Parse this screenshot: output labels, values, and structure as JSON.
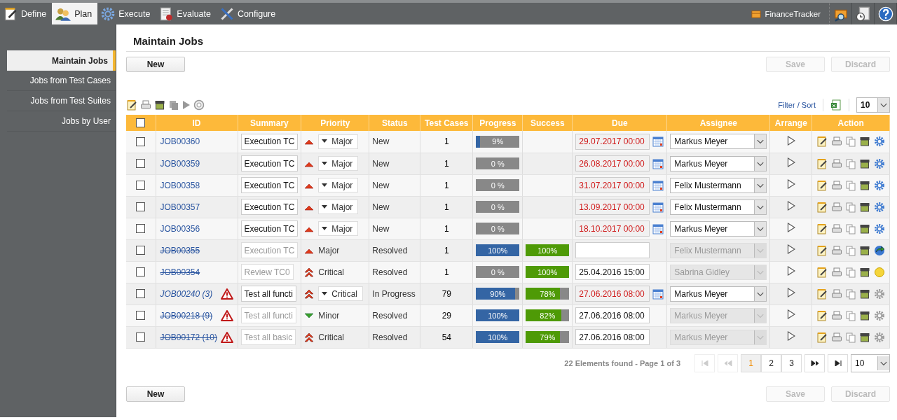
{
  "app": {
    "tabs": [
      {
        "label": "Define",
        "selected": false
      },
      {
        "label": "Plan",
        "selected": true
      },
      {
        "label": "Execute",
        "selected": false
      },
      {
        "label": "Evaluate",
        "selected": false
      },
      {
        "label": "Configure",
        "selected": false
      }
    ],
    "project": "FinanceTracker"
  },
  "sidebar": {
    "items": [
      {
        "label": "Maintain Jobs",
        "selected": true
      },
      {
        "label": "Jobs from Test Cases",
        "selected": false
      },
      {
        "label": "Jobs from Test Suites",
        "selected": false
      },
      {
        "label": "Jobs by User",
        "selected": false
      }
    ]
  },
  "page": {
    "title": "Maintain Jobs",
    "top_buttons": [
      {
        "label": "New",
        "disabled": false
      },
      {
        "label": "Save",
        "disabled": true
      },
      {
        "label": "Discard",
        "disabled": true
      }
    ],
    "bottom_buttons": [
      {
        "label": "New",
        "disabled": false
      },
      {
        "label": "Save",
        "disabled": true
      },
      {
        "label": "Discard",
        "disabled": true
      }
    ],
    "filter_link": "Filter / Sort",
    "page_size": "10"
  },
  "table": {
    "header_checked": false,
    "columns": [
      "ID",
      "Summary",
      "Priority",
      "Status",
      "Test Cases",
      "Progress",
      "Success",
      "Due",
      "Assignee",
      "Arrange",
      "Action"
    ],
    "rows": [
      {
        "checked": false,
        "id": "JOB00360",
        "struck": false,
        "italic": false,
        "warning": false,
        "summary": "Execution TC",
        "editable": true,
        "priority": {
          "label": "Major",
          "kind": "major"
        },
        "status": "New",
        "test_cases": "1",
        "progress": {
          "level": 0.09,
          "label": "9%"
        },
        "due": "29.07.2017 00:00",
        "overdue": true,
        "assignee": "Markus Meyer",
        "last_action": {
          "kind": "configure"
        }
      },
      {
        "checked": false,
        "id": "JOB00359",
        "struck": false,
        "italic": false,
        "warning": false,
        "summary": "Execution TC",
        "editable": true,
        "priority": {
          "label": "Major",
          "kind": "major"
        },
        "status": "New",
        "test_cases": "1",
        "progress": {
          "level": 0,
          "label": "0 %"
        },
        "due": "26.08.2017 00:00",
        "overdue": true,
        "assignee": "Markus Meyer",
        "last_action": {
          "kind": "configure"
        }
      },
      {
        "checked": false,
        "id": "JOB00358",
        "struck": false,
        "italic": false,
        "warning": false,
        "summary": "Execution TC",
        "editable": true,
        "priority": {
          "label": "Major",
          "kind": "major"
        },
        "status": "New",
        "test_cases": "1",
        "progress": {
          "level": 0,
          "label": "0 %"
        },
        "due": "31.07.2017 00:00",
        "overdue": true,
        "assignee": "Felix Mustermann",
        "last_action": {
          "kind": "configure"
        }
      },
      {
        "checked": false,
        "id": "JOB00357",
        "struck": false,
        "italic": false,
        "warning": false,
        "summary": "Execution TC",
        "editable": true,
        "priority": {
          "label": "Major",
          "kind": "major"
        },
        "status": "New",
        "test_cases": "1",
        "progress": {
          "level": 0,
          "label": "0 %"
        },
        "due": "13.09.2017 00:00",
        "overdue": true,
        "assignee": "Felix Mustermann",
        "last_action": {
          "kind": "configure"
        }
      },
      {
        "checked": false,
        "id": "JOB00356",
        "struck": false,
        "italic": false,
        "warning": false,
        "summary": "Execution TC",
        "editable": true,
        "priority": {
          "label": "Major",
          "kind": "major"
        },
        "status": "New",
        "test_cases": "1",
        "progress": {
          "level": 0,
          "label": "0 %"
        },
        "due": "18.10.2017 00:00",
        "overdue": true,
        "assignee": "Markus Meyer",
        "last_action": {
          "kind": "configure"
        }
      },
      {
        "checked": false,
        "id": "JOB00355",
        "struck": true,
        "italic": false,
        "warning": false,
        "summary": "Execution TC",
        "editable": false,
        "priority": {
          "label": "Major",
          "kind": "major"
        },
        "status": "Resolved",
        "test_cases": "1",
        "progress": {
          "level": 1,
          "label": "100%"
        },
        "success": {
          "level": 1,
          "label": "100%"
        },
        "overdue": false,
        "assignee": "Felix Mustermann",
        "last_action": {
          "kind": "reopen"
        }
      },
      {
        "checked": false,
        "id": "JOB00354",
        "struck": true,
        "italic": false,
        "warning": false,
        "summary": "Review TC0",
        "editable": false,
        "priority": {
          "label": "Critical",
          "kind": "critical"
        },
        "status": "Resolved",
        "test_cases": "1",
        "progress": {
          "level": 0,
          "label": "0 %"
        },
        "success": {
          "level": 1,
          "label": "100%"
        },
        "due": "25.04.2016 15:00",
        "overdue": false,
        "assignee": "Sabrina Gidley",
        "last_action": {
          "kind": "pending"
        }
      },
      {
        "checked": false,
        "id": "JOB00240 (3)",
        "struck": false,
        "italic": true,
        "warning": true,
        "summary": "Test all functi",
        "editable": true,
        "priority": {
          "label": "Critical",
          "kind": "critical"
        },
        "status": "In Progress",
        "test_cases": "79",
        "progress": {
          "level": 0.9,
          "label": "90%"
        },
        "success": {
          "level": 0.78,
          "label": "78%"
        },
        "due": "27.06.2016 08:00",
        "overdue": true,
        "assignee": "Markus Meyer",
        "last_action": {
          "kind": "inactive"
        }
      },
      {
        "checked": false,
        "id": "JOB00218 (9)",
        "struck": true,
        "italic": false,
        "warning": true,
        "summary": "Test all functi",
        "editable": false,
        "priority": {
          "label": "Minor",
          "kind": "minor"
        },
        "status": "Resolved",
        "test_cases": "29",
        "progress": {
          "level": 1,
          "label": "100%"
        },
        "success": {
          "level": 0.82,
          "label": "82%"
        },
        "due": "27.06.2016 08:00",
        "overdue": false,
        "assignee": "Markus Meyer",
        "last_action": {
          "kind": "inactive"
        }
      },
      {
        "checked": false,
        "id": "JOB00172 (10)",
        "struck": true,
        "italic": false,
        "warning": true,
        "summary": "Test all basic",
        "editable": false,
        "priority": {
          "label": "Critical",
          "kind": "critical"
        },
        "status": "Resolved",
        "test_cases": "54",
        "progress": {
          "level": 1,
          "label": "100%"
        },
        "success": {
          "level": 0.79,
          "label": "79%"
        },
        "due": "27.06.2016 08:00",
        "overdue": false,
        "assignee": "Markus Meyer",
        "last_action": {
          "kind": "inactive"
        }
      }
    ]
  },
  "pagination": {
    "summary": "22 Elements found - Page 1 of 3",
    "first_disabled": true,
    "prev_disabled": true,
    "next_disabled": false,
    "last_disabled": false,
    "pages": [
      {
        "label": "1",
        "selected": true
      },
      {
        "label": "2",
        "selected": false
      },
      {
        "label": "3",
        "selected": false
      }
    ],
    "page_size": "10"
  }
}
